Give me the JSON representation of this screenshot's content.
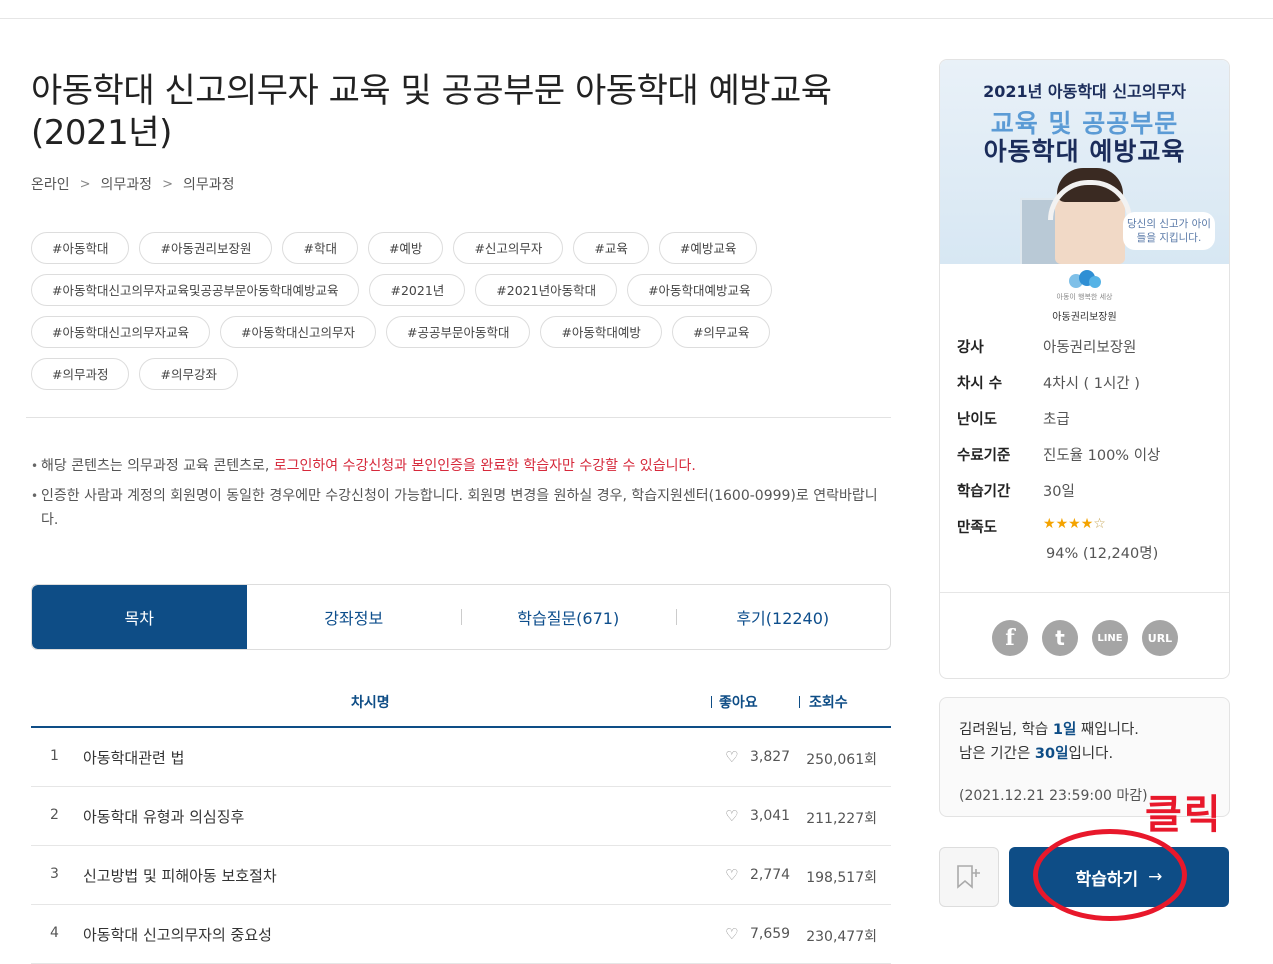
{
  "course": {
    "title": "아동학대 신고의무자 교육 및 공공부문 아동학대 예방교육 (2021년)",
    "breadcrumb": [
      "온라인",
      "의무과정",
      "의무과정"
    ]
  },
  "tags": [
    "#아동학대",
    "#아동권리보장원",
    "#학대",
    "#예방",
    "#신고의무자",
    "#교육",
    "#예방교육",
    "#아동학대신고의무자교육및공공부문아동학대예방교육",
    "#2021년",
    "#2021년아동학대",
    "#아동학대예방교육",
    "#아동학대신고의무자교육",
    "#아동학대신고의무자",
    "#공공부문아동학대",
    "#아동학대예방",
    "#의무교육",
    "#의무과정",
    "#의무강좌"
  ],
  "notices": {
    "n1_prefix": "해당 콘텐츠는 의무과정 교육 콘텐츠로, ",
    "n1_highlight": "로그인하여 수강신청과 본인인증을 완료한 학습자만 수강할 수 있습니다.",
    "n2": "인증한 사람과 계정의 회원명이 동일한 경우에만 수강신청이 가능합니다. 회원명 변경을 원하실 경우, 학습지원센터(1600-0999)로 연락바랍니다."
  },
  "tabs": [
    "목차",
    "강좌정보",
    "학습질문(671)",
    "후기(12240)"
  ],
  "table": {
    "headers": {
      "name": "차시명",
      "likes": "좋아요",
      "views": "조회수"
    },
    "rows": [
      {
        "num": "1",
        "name": "아동학대관련 법",
        "likes": "3,827",
        "views": "250,061회"
      },
      {
        "num": "2",
        "name": "아동학대 유형과 의심징후",
        "likes": "3,041",
        "views": "211,227회"
      },
      {
        "num": "3",
        "name": "신고방법 및 피해아동 보호절차",
        "likes": "2,774",
        "views": "198,517회"
      },
      {
        "num": "4",
        "name": "아동학대 신고의무자의 중요성",
        "likes": "7,659",
        "views": "230,477회"
      }
    ]
  },
  "banner": {
    "line1": "2021년 아동학대 신고의무자",
    "line2": "교육 및 공공부문",
    "line3": "아동학대 예방교육",
    "bubble": "당신의 신고가 아이들을 지킵니다.",
    "org": "아동권리보장원",
    "org_small": "아동이 행복한 세상"
  },
  "info": {
    "instructor_label": "강사",
    "instructor": "아동권리보장원",
    "sessions_label": "차시 수",
    "sessions": "4차시 ( 1시간 )",
    "level_label": "난이도",
    "level": "초급",
    "criteria_label": "수료기준",
    "criteria": "진도율 100% 이상",
    "period_label": "학습기간",
    "period": "30일",
    "satisfaction_label": "만족도",
    "satisfaction_rating": 4,
    "satisfaction_detail": "94% (12,240명)"
  },
  "share": {
    "facebook": "f",
    "twitter": "t",
    "line": "LINE",
    "url": "URL"
  },
  "status": {
    "user": "김려원",
    "line1_a": "님, 학습 ",
    "line1_day": "1일",
    "line1_b": " 째입니다.",
    "line2_a": "남은 기간은 ",
    "line2_day": "30일",
    "line2_b": "입니다.",
    "deadline": "(2021.12.21 23:59:00 마감)"
  },
  "annotation": {
    "click_label": "클릭"
  },
  "actions": {
    "study_label": "학습하기",
    "study_arrow": "→"
  },
  "colors": {
    "primary": "#0e4d86",
    "highlight_red": "#d6293b",
    "annotation_red": "#e8182b"
  }
}
